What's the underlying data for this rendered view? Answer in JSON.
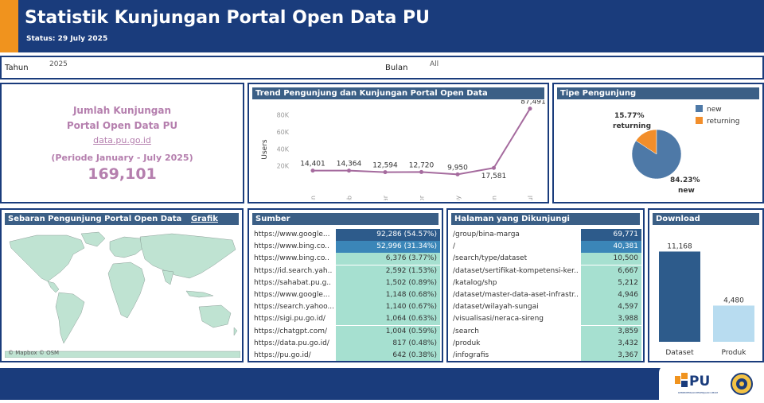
{
  "header": {
    "title": "Statistik Kunjungan Portal Open Data PU",
    "status": "Status: 29 July 2025"
  },
  "filters": {
    "tahun_label": "Tahun",
    "tahun_value": "2025",
    "bulan_label": "Bulan",
    "bulan_value": "All"
  },
  "kpi": {
    "line1": "Jumlah Kunjungan",
    "line2": "Portal Open Data PU",
    "link": "data.pu.go.id",
    "period": "(Periode January - July 2025)",
    "total": "169,101"
  },
  "trend": {
    "title": "Trend Pengunjung dan Kunjungan Portal Open Data",
    "ylabel": "Users"
  },
  "tipe": {
    "title": "Tipe Pengunjung",
    "legend_new": "new",
    "legend_returning": "returning",
    "returning_pct": "15.77%",
    "returning_label": "returning",
    "new_pct": "84.23%",
    "new_label": "new",
    "color_new": "#4e79a7",
    "color_returning": "#f28e2b"
  },
  "map": {
    "title": "Sebaran Pengunjung Portal Open Data",
    "grafik_link": "Grafik",
    "attribution": "© Mapbox © OSM"
  },
  "sumber": {
    "title": "Sumber",
    "rows": [
      {
        "name": "https://www.google...",
        "value": "92,286 (54.57%)"
      },
      {
        "name": "https://www.bing.co..",
        "value": "52,996 (31.34%)"
      },
      {
        "name": "https://www.bing.co..",
        "value": "6,376 (3.77%)"
      },
      {
        "name": "https://id.search.yah..",
        "value": "2,592 (1.53%)"
      },
      {
        "name": "https://sahabat.pu.g..",
        "value": "1,502 (0.89%)"
      },
      {
        "name": "https://www.google...",
        "value": "1,148 (0.68%)"
      },
      {
        "name": "https://search.yahoo...",
        "value": "1,140 (0.67%)"
      },
      {
        "name": "https://sigi.pu.go.id/",
        "value": "1,064 (0.63%)"
      },
      {
        "name": "https://chatgpt.com/",
        "value": "1,004 (0.59%)"
      },
      {
        "name": "https://data.pu.go.id/",
        "value": "817 (0.48%)"
      },
      {
        "name": "https://pu.go.id/",
        "value": "642 (0.38%)"
      }
    ]
  },
  "halaman": {
    "title": "Halaman yang Dikunjungi",
    "rows": [
      {
        "name": "/group/bina-marga",
        "value": "69,771"
      },
      {
        "name": "/",
        "value": "40,381"
      },
      {
        "name": "/search/type/dataset",
        "value": "10,500"
      },
      {
        "name": "/dataset/sertifikat-kompetensi-ker..",
        "value": "6,667"
      },
      {
        "name": "/katalog/shp",
        "value": "5,212"
      },
      {
        "name": "/dataset/master-data-aset-infrastr..",
        "value": "4,946"
      },
      {
        "name": "/dataset/wilayah-sungai",
        "value": "4,597"
      },
      {
        "name": "/visualisasi/neraca-sireng",
        "value": "3,988"
      },
      {
        "name": "/search",
        "value": "3,859"
      },
      {
        "name": "/produk",
        "value": "3,432"
      },
      {
        "name": "/infografis",
        "value": "3,367"
      }
    ]
  },
  "download": {
    "title": "Download"
  },
  "footer": {
    "logo_text": "PU",
    "logo_sub": "KEMENTERIAN PEKERJAAN UMUM",
    "color_primary": "#1a3c7c",
    "color_accent": "#f0931e"
  },
  "chart_data": [
    {
      "type": "line",
      "x": [
        "Jan",
        "Feb",
        "Mar",
        "Apr",
        "May",
        "Jun",
        "Jul"
      ],
      "series": [
        {
          "values": [
            14401,
            14364,
            12594,
            12720,
            9950,
            17581,
            87491
          ]
        }
      ],
      "data_labels": [
        "14,401",
        "14,364",
        "12,594",
        "12,720",
        "9,950",
        "17,581",
        "87,491"
      ],
      "yticks": [
        "20K",
        "40K",
        "60K",
        "80K"
      ],
      "ylabel": "Users",
      "ylim": [
        0,
        90000
      ],
      "grid": false,
      "color": "#a56b9e"
    },
    {
      "type": "pie",
      "labels": [
        "new",
        "returning"
      ],
      "values": [
        84.23,
        15.77
      ],
      "colors": [
        "#4e79a7",
        "#f28e2b"
      ],
      "legend": "top-right"
    },
    {
      "type": "bar",
      "categories": [
        "Dataset",
        "Produk"
      ],
      "values": [
        11168,
        4480
      ],
      "data_labels": [
        "11,168",
        "4,480"
      ],
      "colors": [
        "#2d5b8b",
        "#b8dcf0"
      ],
      "ylim": [
        0,
        12000
      ]
    },
    {
      "type": "table",
      "name": "Sumber",
      "values": [
        92286,
        52996,
        6376,
        2592,
        1502,
        1148,
        1140,
        1064,
        1004,
        817,
        642
      ]
    },
    {
      "type": "table",
      "name": "Halaman yang Dikunjungi",
      "values": [
        69771,
        40381,
        10500,
        6667,
        5212,
        4946,
        4597,
        3988,
        3859,
        3432,
        3367
      ]
    }
  ]
}
